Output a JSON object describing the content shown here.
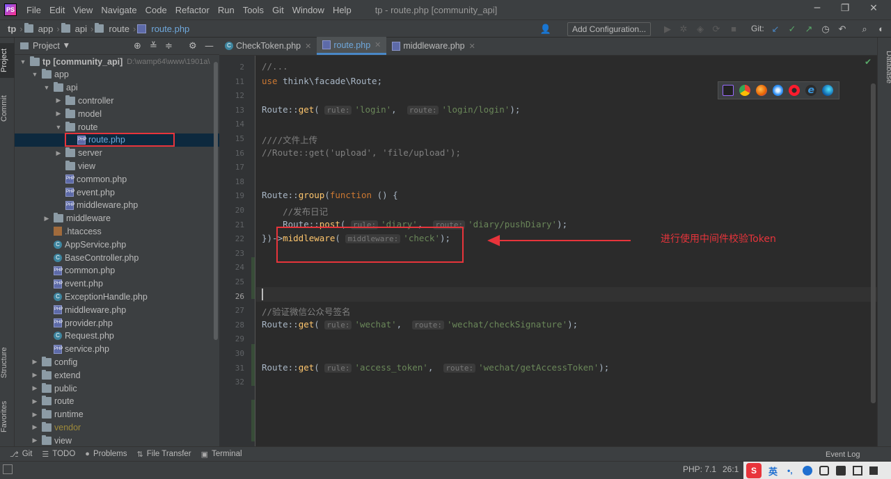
{
  "app": {
    "logo": "PS",
    "window_title": "tp - route.php [community_api]"
  },
  "menu": [
    "File",
    "Edit",
    "View",
    "Navigate",
    "Code",
    "Refactor",
    "Run",
    "Tools",
    "Git",
    "Window",
    "Help"
  ],
  "breadcrumb": [
    "tp",
    "app",
    "api",
    "route",
    "route.php"
  ],
  "toolbar": {
    "add_configuration": "Add Configuration...",
    "git_label": "Git:"
  },
  "left_strip": {
    "project": "Project",
    "commit": "Commit",
    "structure": "Structure",
    "favorites": "Favorites"
  },
  "right_strip": {
    "database": "Database"
  },
  "project_panel": {
    "title": "Project"
  },
  "tree": [
    {
      "label": "tp [community_api]",
      "path": "D:\\wamp64\\www\\1901a\\",
      "type": "folder",
      "depth": 0,
      "open": true
    },
    {
      "label": "app",
      "type": "folder",
      "depth": 1,
      "open": true
    },
    {
      "label": "api",
      "type": "folder",
      "depth": 2,
      "open": true
    },
    {
      "label": "controller",
      "type": "folder",
      "depth": 3,
      "open": false
    },
    {
      "label": "model",
      "type": "folder",
      "depth": 3,
      "open": false
    },
    {
      "label": "route",
      "type": "folder",
      "depth": 3,
      "open": true
    },
    {
      "label": "route.php",
      "type": "php",
      "depth": 4,
      "selected": true
    },
    {
      "label": "server",
      "type": "folder",
      "depth": 3,
      "open": false
    },
    {
      "label": "view",
      "type": "folder",
      "depth": 3,
      "leaf": true
    },
    {
      "label": "common.php",
      "type": "php",
      "depth": 3
    },
    {
      "label": "event.php",
      "type": "php",
      "depth": 3
    },
    {
      "label": "middleware.php",
      "type": "php",
      "depth": 3
    },
    {
      "label": "middleware",
      "type": "folder",
      "depth": 2,
      "open": false
    },
    {
      "label": ".htaccess",
      "type": "ht",
      "depth": 2
    },
    {
      "label": "AppService.php",
      "type": "class",
      "depth": 2
    },
    {
      "label": "BaseController.php",
      "type": "class",
      "depth": 2
    },
    {
      "label": "common.php",
      "type": "php",
      "depth": 2
    },
    {
      "label": "event.php",
      "type": "php",
      "depth": 2
    },
    {
      "label": "ExceptionHandle.php",
      "type": "class",
      "depth": 2
    },
    {
      "label": "middleware.php",
      "type": "php",
      "depth": 2
    },
    {
      "label": "provider.php",
      "type": "php",
      "depth": 2
    },
    {
      "label": "Request.php",
      "type": "class",
      "depth": 2
    },
    {
      "label": "service.php",
      "type": "php",
      "depth": 2
    },
    {
      "label": "config",
      "type": "folder",
      "depth": 1,
      "open": false
    },
    {
      "label": "extend",
      "type": "folder",
      "depth": 1,
      "open": false
    },
    {
      "label": "public",
      "type": "folder",
      "depth": 1,
      "open": false
    },
    {
      "label": "route",
      "type": "folder",
      "depth": 1,
      "open": false
    },
    {
      "label": "runtime",
      "type": "folder",
      "depth": 1,
      "open": false
    },
    {
      "label": "vendor",
      "type": "folder",
      "depth": 1,
      "open": false,
      "vendor": true
    },
    {
      "label": "view",
      "type": "folder",
      "depth": 1,
      "open": false
    }
  ],
  "tabs": [
    {
      "label": "CheckToken.php",
      "active": false
    },
    {
      "label": "route.php",
      "active": true
    },
    {
      "label": "middleware.php",
      "active": false
    }
  ],
  "code_lines": [
    {
      "n": "2",
      "html": "<span class=\"cm\">//...</span>"
    },
    {
      "n": "11",
      "html": "<span class=\"kw\">use</span> think\\facade\\Route;"
    },
    {
      "n": "12",
      "html": ""
    },
    {
      "n": "13",
      "html": "Route::<span class=\"fn\">get</span>( <span class=\"hint\">rule:</span><span class=\"str\">'login'</span>,  <span class=\"hint\">route:</span><span class=\"str\">'login/login'</span>);"
    },
    {
      "n": "14",
      "html": ""
    },
    {
      "n": "15",
      "html": "<span class=\"cm\">////文件上传</span>"
    },
    {
      "n": "16",
      "html": "<span class=\"cm\">//Route::get('upload', 'file/upload');</span>"
    },
    {
      "n": "17",
      "html": ""
    },
    {
      "n": "18",
      "html": ""
    },
    {
      "n": "19",
      "html": "Route::<span class=\"fn\">group</span>(<span class=\"kw\">function</span> () {"
    },
    {
      "n": "20",
      "html": "    <span class=\"cm\">//发布日记</span>"
    },
    {
      "n": "21",
      "html": "    Route::<span class=\"fn\">post</span>( <span class=\"hint\">rule:</span><span class=\"str\">'diary'</span>,  <span class=\"hint\">route:</span><span class=\"str\">'diary/pushDiary'</span>);"
    },
    {
      "n": "22",
      "html": "})-><span class=\"fn\">middleware</span>( <span class=\"hint\">middleware:</span><span class=\"str\">'check'</span>);"
    },
    {
      "n": "23",
      "html": ""
    },
    {
      "n": "24",
      "html": ""
    },
    {
      "n": "25",
      "html": ""
    },
    {
      "n": "26",
      "html": ""
    },
    {
      "n": "27",
      "html": "<span class=\"cm\">//验证微信公众号签名</span>"
    },
    {
      "n": "28",
      "html": "Route::<span class=\"fn\">get</span>( <span class=\"hint\">rule:</span><span class=\"str\">'wechat'</span>,  <span class=\"hint\">route:</span><span class=\"str\">'wechat/checkSignature'</span>);"
    },
    {
      "n": "29",
      "html": ""
    },
    {
      "n": "30",
      "html": ""
    },
    {
      "n": "31",
      "html": "Route::<span class=\"fn\">get</span>( <span class=\"hint\">rule:</span><span class=\"str\">'access_token'</span>,  <span class=\"hint\">route:</span><span class=\"str\">'wechat/getAccessToken'</span>);"
    },
    {
      "n": "32",
      "html": ""
    }
  ],
  "annotation": "进行使用中间件校验Token",
  "bottom_tools": [
    "Git",
    "TODO",
    "Problems",
    "File Transfer",
    "Terminal"
  ],
  "event_log": "Event Log",
  "status": {
    "php": "PHP: 7.1",
    "position": "26:1",
    "ime": "英"
  },
  "colors": {
    "accent": "#4a88c7",
    "annotation": "#e8343b",
    "selection": "#0d293e"
  }
}
